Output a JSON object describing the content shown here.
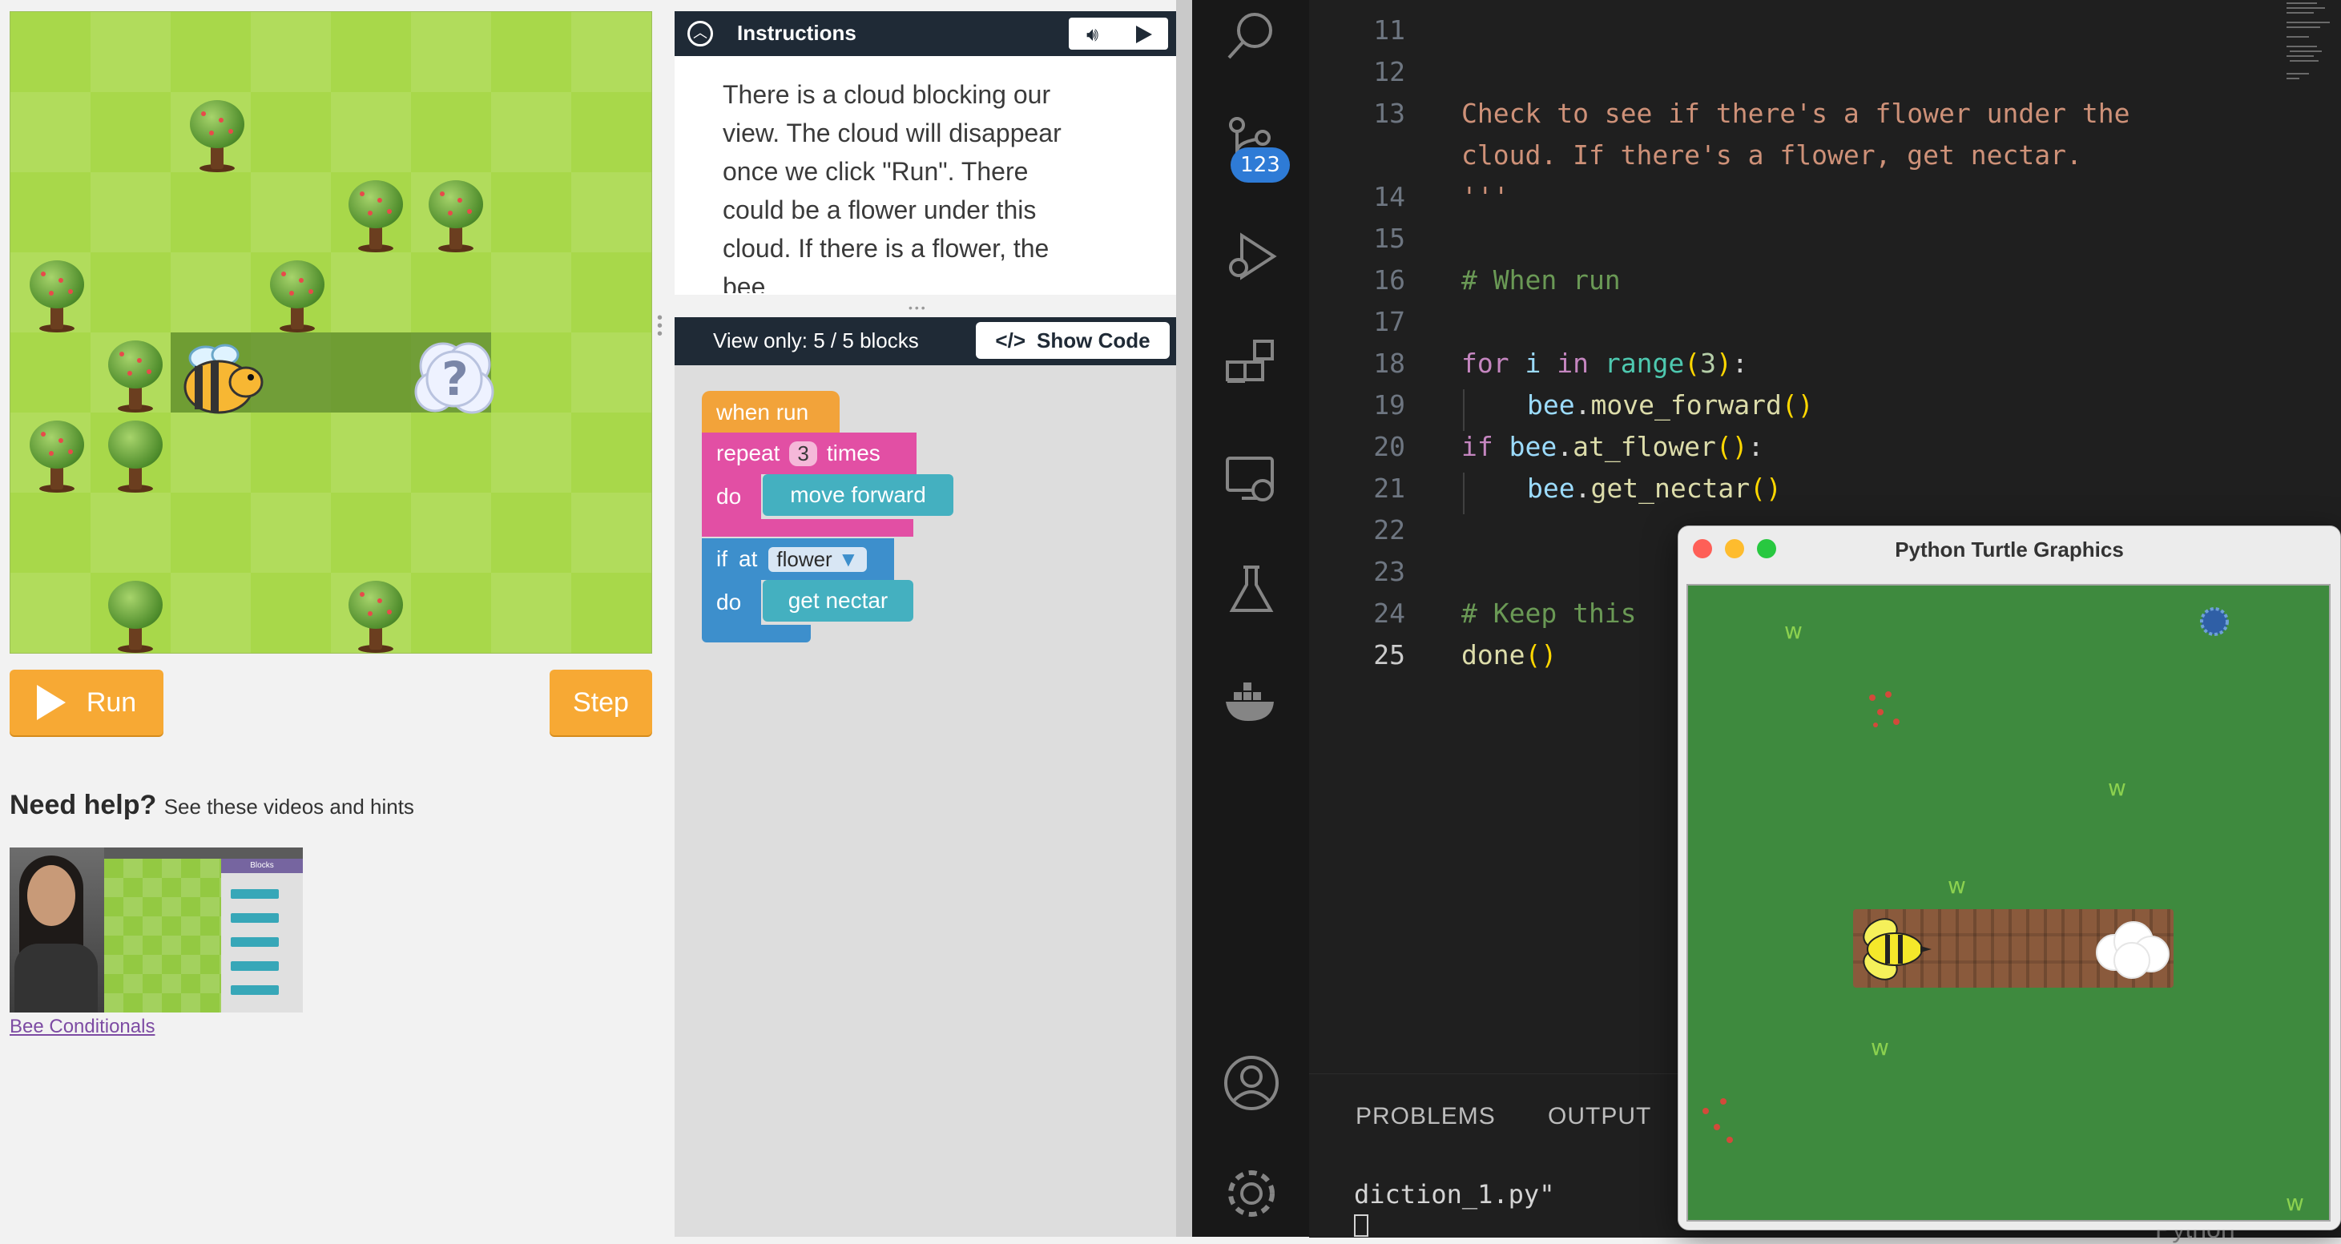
{
  "codeorg": {
    "run_label": "Run",
    "step_label": "Step",
    "instructions": {
      "title": "Instructions",
      "text": "There is a cloud blocking our view. The cloud will disappear once we click \"Run\". There could be a flower under this cloud. If there is a flower, the bee"
    },
    "workspace": {
      "view_only": "View only: 5 / 5 blocks",
      "show_code_label": "Show Code"
    },
    "blocks": {
      "when_run": "when run",
      "repeat": "repeat",
      "repeat_count": "3",
      "times": "times",
      "do": "do",
      "move_forward": "move forward",
      "if": "if",
      "at": "at",
      "flower": "flower",
      "get_nectar": "get nectar"
    },
    "help": {
      "heading": "Need help?",
      "sub": "See these videos and hints",
      "video_link": "Bee Conditionals",
      "thumb_header": "Blocks"
    }
  },
  "vscode": {
    "scm_badge": "123",
    "lines": [
      "11",
      "12",
      "13",
      "",
      "14",
      "15",
      "16",
      "17",
      "18",
      "19",
      "20",
      "21",
      "22",
      "23",
      "24",
      "25"
    ],
    "code": {
      "l13a": "Check to see if there's a flower under the",
      "l13b": "cloud. If there's a flower, get nectar.",
      "l14": "'''",
      "l16": "# When run",
      "l18_kw": "for",
      "l18_var": "i",
      "l18_in": "in",
      "l18_fn": "range",
      "l18_num": "3",
      "l19_obj": "bee",
      "l19_m": "move_forward",
      "l20_kw": "if",
      "l20_obj": "bee",
      "l20_m": "at_flower",
      "l21_obj": "bee",
      "l21_m": "get_nectar",
      "l24": "# Keep this",
      "l25": "done"
    },
    "panel": {
      "tab_problems": "PROBLEMS",
      "tab_output": "OUTPUT",
      "terminal": "diction_1.py\"",
      "status": "Python"
    },
    "turtle_window_title": "Python Turtle Graphics"
  },
  "colors": {
    "orange": "#f7a934",
    "navy": "#1f2a36",
    "repeat_pink": "#e24fa4",
    "if_blue": "#3d8fcc",
    "action_teal": "#44b0c0"
  }
}
